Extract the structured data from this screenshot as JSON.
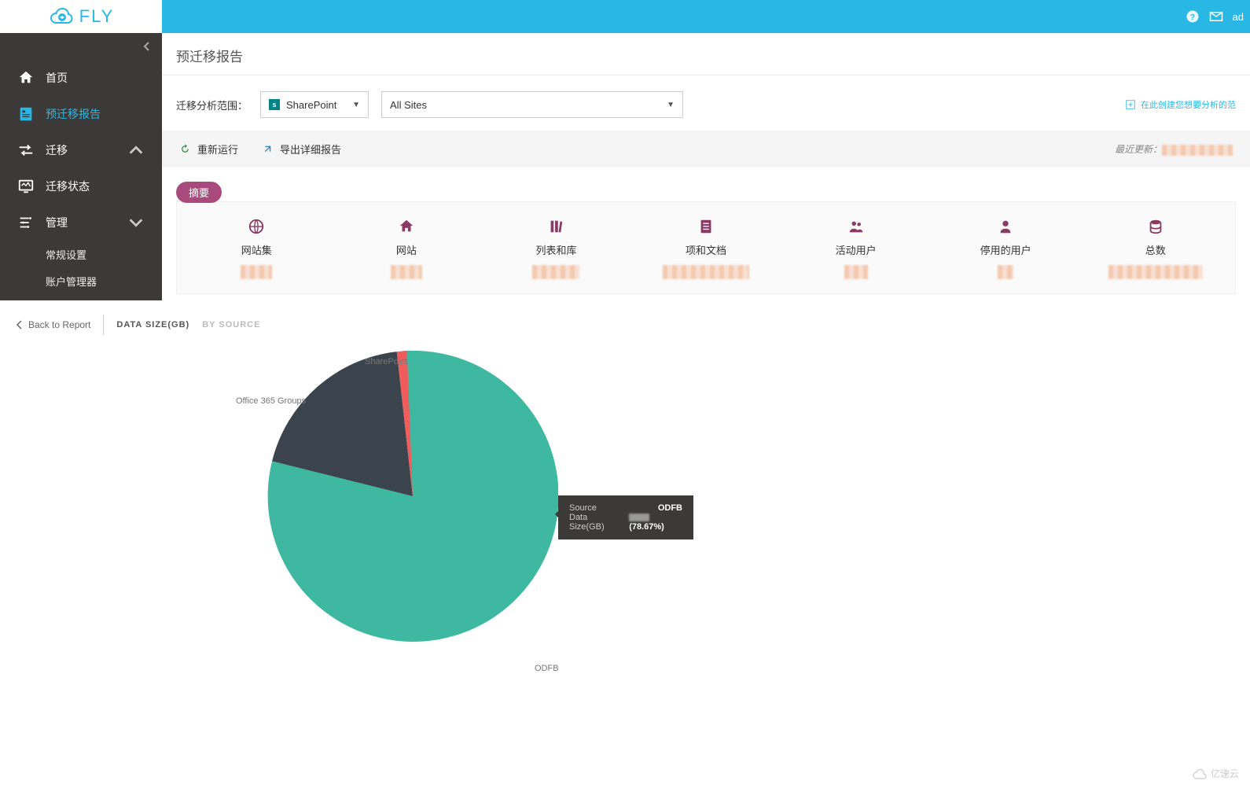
{
  "brand": "FLY",
  "topbar": {
    "user": "ad"
  },
  "sidebar": {
    "home": "首页",
    "premig": "预迁移报告",
    "mig": "迁移",
    "status": "迁移状态",
    "manage": "管理",
    "manage_sub1": "常规设置",
    "manage_sub2": "账户管理器"
  },
  "page": {
    "title": "预迁移报告",
    "scope_label": "迁移分析范围：",
    "dd_sharepoint": "SharePoint",
    "dd_sites": "All Sites",
    "create_link": "在此创建您想要分析的范"
  },
  "actions": {
    "rerun": "重新运行",
    "export": "导出详细报告",
    "last_update": "最近更新："
  },
  "summary": {
    "badge": "摘要",
    "items": [
      {
        "label": "网站集"
      },
      {
        "label": "网站"
      },
      {
        "label": "列表和库"
      },
      {
        "label": "项和文档"
      },
      {
        "label": "活动用户"
      },
      {
        "label": "停用的用户"
      },
      {
        "label": "总数"
      }
    ]
  },
  "chart_tabs": {
    "back": "Back to Report",
    "tab1": "DATA SIZE(GB)",
    "tab2": "BY SOURCE"
  },
  "chart_data": {
    "type": "pie",
    "title": "Data Size(GB) By Source",
    "series": [
      {
        "name": "ODFB",
        "percent": 78.67,
        "color": "#3fb8a1"
      },
      {
        "name": "Office 365 Groups",
        "percent": 20.33,
        "color": "#3b444d"
      },
      {
        "name": "SharePoint",
        "percent": 1.0,
        "color": "#f05b5b"
      }
    ],
    "labels": {
      "odfb": "ODFB",
      "o365": "Office 365 Groups",
      "sp": "SharePoint"
    },
    "tooltip": {
      "source_label": "Source",
      "source_val": "ODFB",
      "size_label": "Data Size(GB)",
      "size_pct": "(78.67%)"
    }
  },
  "watermark": "亿速云"
}
